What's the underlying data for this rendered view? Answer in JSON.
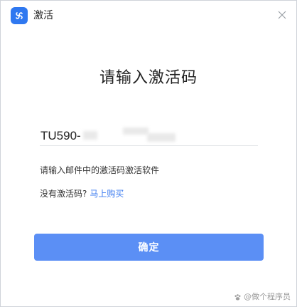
{
  "window": {
    "title": "激活",
    "app_icon": "fan-logo-icon",
    "close_icon": "close-icon"
  },
  "main": {
    "heading": "请输入激活码",
    "code_input_value": "TU590-",
    "hint": "请输入邮件中的激活码激活软件",
    "no_code_label": "没有激活码?",
    "buy_link_label": "马上购买",
    "confirm_label": "确定"
  },
  "watermark": {
    "icon": "paw-icon",
    "text": "@做个程序员"
  },
  "colors": {
    "accent": "#2f78f0",
    "button": "#5b8ff5",
    "link": "#3d7cf0"
  }
}
